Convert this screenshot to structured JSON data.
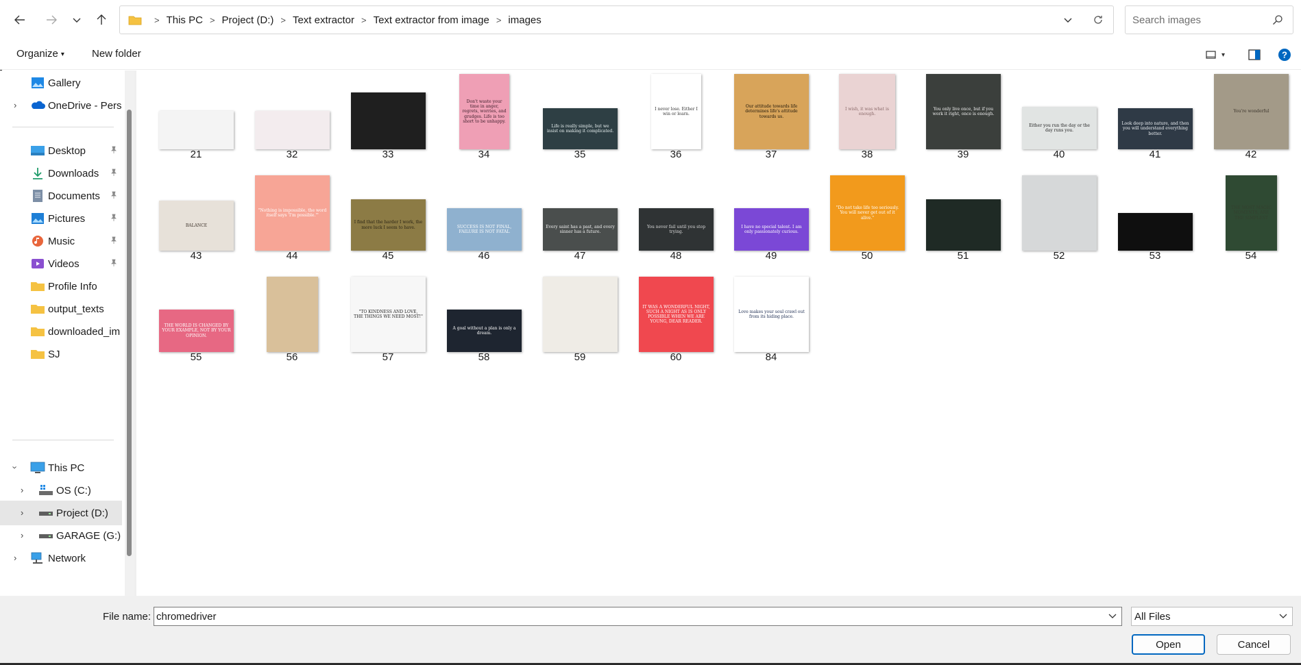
{
  "address": {
    "crumbs": [
      "This PC",
      "Project  (D:)",
      "Text extractor",
      "Text extractor from image",
      "images"
    ]
  },
  "search": {
    "placeholder": "Search images"
  },
  "toolbar": {
    "organize_label": "Organize",
    "new_folder_label": "New folder"
  },
  "nav": {
    "gallery": "Gallery",
    "onedrive": "OneDrive - Perso",
    "desktop": "Desktop",
    "downloads": "Downloads",
    "documents": "Documents",
    "pictures": "Pictures",
    "music": "Music",
    "videos": "Videos",
    "profile_info": "Profile Info",
    "output_texts": "output_texts",
    "downloaded_im": "downloaded_im",
    "sj": "SJ",
    "this_pc": "This PC",
    "os_c": "OS (C:)",
    "project_d": "Project  (D:)",
    "garage_g": "GARAGE (G:)",
    "network": "Network"
  },
  "files": [
    {
      "name": "21",
      "thumb_text": "",
      "bg": "#f4f4f4",
      "fg": "#222222"
    },
    {
      "name": "32",
      "thumb_text": "",
      "bg": "#f3ecee",
      "fg": "#555555"
    },
    {
      "name": "33",
      "thumb_text": "",
      "bg": "#1f1f1f",
      "fg": "#ffffff"
    },
    {
      "name": "34",
      "thumb_text": "Don't waste your time in anger, regrets, worries, and grudges. Life is too short to be unhappy.",
      "bg": "#ef9fb5",
      "fg": "#3a1c28"
    },
    {
      "name": "35",
      "thumb_text": "Life is really simple, but we insist on making it complicated.",
      "bg": "#2e3f44",
      "fg": "#e9f1f1"
    },
    {
      "name": "36",
      "thumb_text": "I never lose. Either I win or learn.",
      "bg": "#ffffff",
      "fg": "#333333"
    },
    {
      "name": "37",
      "thumb_text": "Our attitude towards life determines life's attitude towards us.",
      "bg": "#d8a45a",
      "fg": "#1c1408"
    },
    {
      "name": "38",
      "thumb_text": "I wish, it was what is enough.",
      "bg": "#ead3d3",
      "fg": "#8a6a6a"
    },
    {
      "name": "39",
      "thumb_text": "You only live once, but if you work it right, once is enough.",
      "bg": "#3b3f3c",
      "fg": "#f2f2f2"
    },
    {
      "name": "40",
      "thumb_text": "Either you run the day or the day runs you.",
      "bg": "#e1e4e3",
      "fg": "#222222"
    },
    {
      "name": "41",
      "thumb_text": "Look deep into nature, and then you will understand everything better.",
      "bg": "#2f3a46",
      "fg": "#eef2f6"
    },
    {
      "name": "42",
      "thumb_text": "You're wonderful",
      "bg": "#a39a88",
      "fg": "#3b342b"
    },
    {
      "name": "43",
      "thumb_text": "BALANCE",
      "bg": "#e7e1d9",
      "fg": "#3b3028"
    },
    {
      "name": "44",
      "thumb_text": "\"Nothing is impossible, the word itself says 'I'm possible.'\"",
      "bg": "#f7a596",
      "fg": "#ffffff"
    },
    {
      "name": "45",
      "thumb_text": "I find that the harder I work, the more luck I seem to have.",
      "bg": "#8c7b45",
      "fg": "#2a2414"
    },
    {
      "name": "46",
      "thumb_text": "SUCCESS IS NOT FINAL, FAILURE IS NOT FATAL",
      "bg": "#8fb1cf",
      "fg": "#ffffff"
    },
    {
      "name": "47",
      "thumb_text": "Every saint has a past, and every sinner has a future.",
      "bg": "#4a4e4d",
      "fg": "#f0f0f0"
    },
    {
      "name": "48",
      "thumb_text": "You never fail until you stop trying.",
      "bg": "#2f3334",
      "fg": "#dcdcdc"
    },
    {
      "name": "49",
      "thumb_text": "I have no special talent. I am only passionately curious.",
      "bg": "#7b48d6",
      "fg": "#ffffff"
    },
    {
      "name": "50",
      "thumb_text": "\"Do not take life too seriously. You will never get out of it alive.\"",
      "bg": "#f29a1c",
      "fg": "#ffffff"
    },
    {
      "name": "51",
      "thumb_text": "",
      "bg": "#1f2a25",
      "fg": "#ffffff"
    },
    {
      "name": "52",
      "thumb_text": "",
      "bg": "#d6d8d9",
      "fg": "#222222"
    },
    {
      "name": "53",
      "thumb_text": "",
      "bg": "#0f0f0f",
      "fg": "#ffffff"
    },
    {
      "name": "54",
      "thumb_text": "THE MOST MAGIC MOMENTS, ARE THE SIMPLEST",
      "bg": "#2f4a33",
      "fg": "#33402f"
    },
    {
      "name": "55",
      "thumb_text": "THE WORLD IS CHANGED BY YOUR EXAMPLE, NOT BY YOUR OPINION.",
      "bg": "#e76883",
      "fg": "#ffffff"
    },
    {
      "name": "56",
      "thumb_text": "",
      "bg": "#d9c09a",
      "fg": "#2a2015"
    },
    {
      "name": "57",
      "thumb_text": "\"TO KINDNESS AND LOVE, THE THINGS WE NEED MOST!\"",
      "bg": "#f7f7f7",
      "fg": "#222222"
    },
    {
      "name": "58",
      "thumb_text": "A goal without a plan is only a dream.",
      "bg": "#1e2530",
      "fg": "#ffffff"
    },
    {
      "name": "59",
      "thumb_text": "",
      "bg": "#efece6",
      "fg": "#6a5e4d"
    },
    {
      "name": "60",
      "thumb_text": "IT WAS A WONDERFUL NIGHT, SUCH A NIGHT AS IS ONLY POSSIBLE WHEN WE ARE YOUNG, DEAR READER.",
      "bg": "#f0484f",
      "fg": "#ffffff"
    },
    {
      "name": "84",
      "thumb_text": "Love makes your soul crawl out from its hiding place.",
      "bg": "#ffffff",
      "fg": "#1b2b50"
    }
  ],
  "bottom": {
    "file_name_label": "File name:",
    "file_name_value": "chromedriver",
    "filter_value": "All Files",
    "open_label": "Open",
    "cancel_label": "Cancel"
  },
  "colors": {
    "accent": "#0067c0",
    "folder": "#f5c242",
    "selection": "#e6e6e6"
  }
}
